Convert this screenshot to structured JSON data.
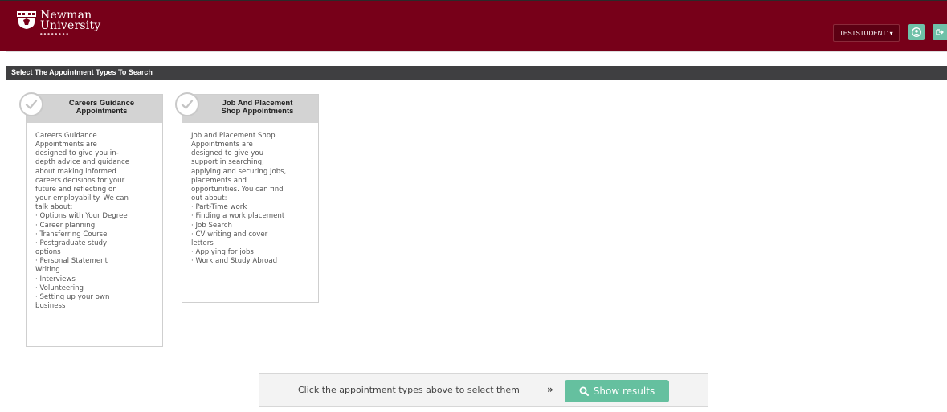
{
  "header": {
    "logo_line1": "Newman",
    "logo_line2": "University",
    "user_label": "TESTSTUDENT1",
    "caret": "▾",
    "profile_icon": "user-circle-icon",
    "logout_icon": "logout-icon",
    "brand_color": "#770019",
    "accent_color": "#6ec1a8"
  },
  "section": {
    "title": "Select The Appointment Types To Search"
  },
  "cards": [
    {
      "title_line1": "Careers Guidance",
      "title_line2": "Appointments",
      "lines": [
        "Careers Guidance",
        "Appointments are",
        "designed to give you in-",
        "depth advice and guidance",
        "about making informed",
        "careers decisions for your",
        "future and reflecting on",
        "your employability. We can",
        "talk about:",
        "· Options with Your Degree",
        "· Career planning",
        "· Transferring Course",
        "· Postgraduate study",
        "options",
        "· Personal Statement",
        "Writing",
        "· Interviews",
        "· Volunteering",
        "· Setting up your own",
        "business"
      ]
    },
    {
      "title_line1": "Job And Placement",
      "title_line2": "Shop Appointments",
      "lines": [
        "Job and Placement Shop",
        "Appointments are",
        "designed to give you",
        "support in searching,",
        "applying and securing jobs,",
        "placements and",
        "opportunities. You can find",
        "out about:",
        "· Part-Time work",
        "· Finding a work placement",
        "· Job Search",
        "· CV writing and cover",
        "letters",
        "· Applying for jobs",
        "· Work and Study Abroad"
      ]
    }
  ],
  "footer": {
    "hint": "Click the appointment types above to select them",
    "arrow": "»",
    "button_label": "Show results",
    "button_icon": "search-icon",
    "button_color": "#65c09f"
  }
}
